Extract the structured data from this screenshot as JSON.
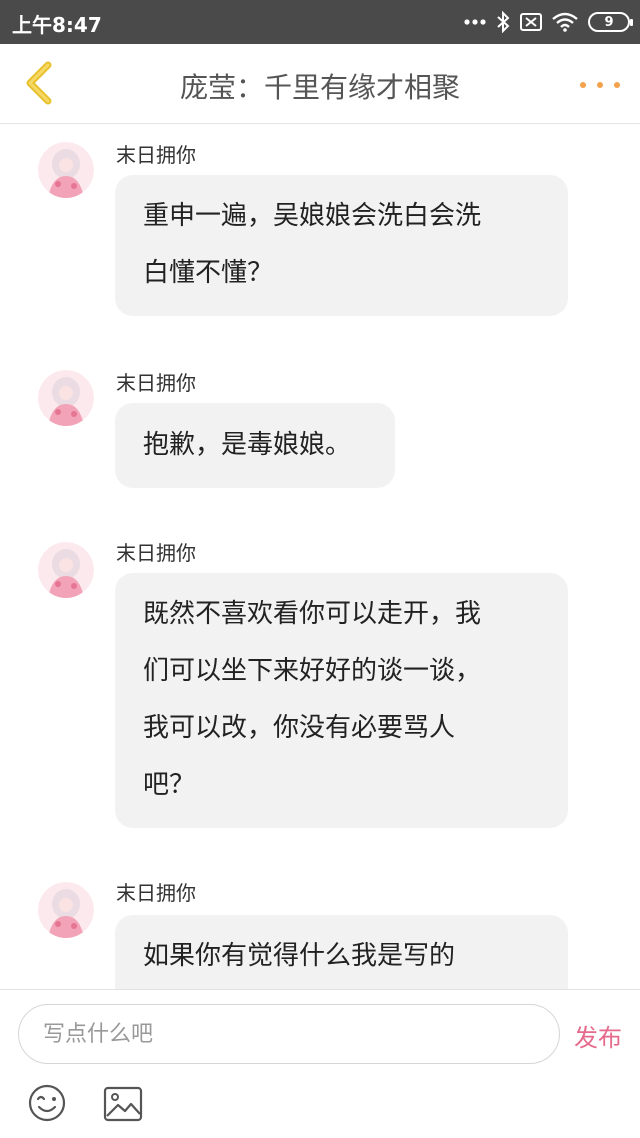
{
  "status_bar": {
    "time": "上午8:47",
    "battery": "9"
  },
  "nav": {
    "title": "庞莹：千里有缘才相聚"
  },
  "messages": [
    {
      "sender": "末日拥你",
      "lines": [
        "重申一遍，吴娘娘会洗白会洗",
        "白懂不懂？"
      ]
    },
    {
      "sender": "末日拥你",
      "lines": [
        "抱歉，是毒娘娘。"
      ]
    },
    {
      "sender": "末日拥你",
      "lines": [
        "既然不喜欢看你可以走开，我",
        "们可以坐下来好好的谈一谈，",
        "我可以改，你没有必要骂人",
        "吧？"
      ]
    },
    {
      "sender": "末日拥你",
      "lines": [
        "如果你有觉得什么我是写的"
      ]
    }
  ],
  "input": {
    "placeholder": "写点什么吧",
    "value": ""
  },
  "publish_label": "发布",
  "colors": {
    "accent_orange": "#f3a24b",
    "back_arrow": "#e8c12e",
    "publish_pink": "#e66a8c",
    "bubble_bg": "#f2f2f2",
    "status_bar_bg": "#4a4a4a"
  },
  "icons": [
    "back-arrow-icon",
    "more-dots-icon",
    "bluetooth-icon",
    "sim-card-icon",
    "wifi-icon",
    "battery-icon",
    "emoji-icon",
    "image-icon"
  ]
}
